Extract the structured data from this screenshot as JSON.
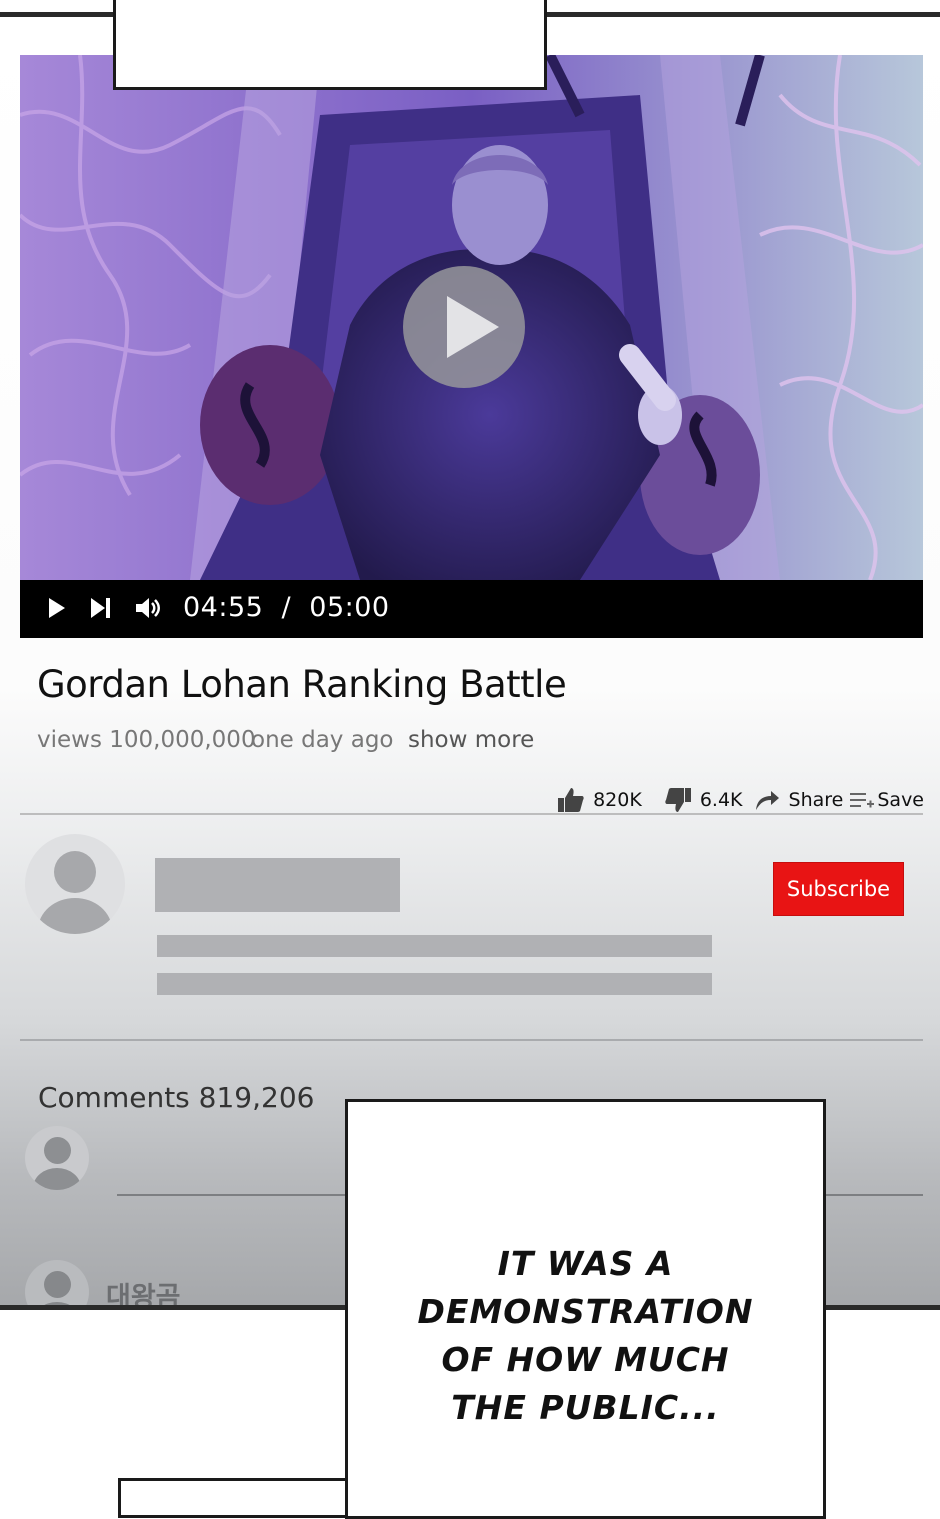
{
  "video": {
    "current_time": "04:55",
    "separator": "/",
    "duration": "05:00"
  },
  "title": "Gordan Lohan Ranking Battle",
  "meta": {
    "views": "views 100,000,000",
    "posted": "one day ago",
    "show_more": "show more"
  },
  "actions": {
    "likes": "820K",
    "dislikes": "6.4K",
    "share": "Share",
    "save": "Save"
  },
  "channel": {
    "subscribe_label": "Subscribe"
  },
  "comments": {
    "header": "Comments 819,206",
    "first_user": "대왕곰"
  },
  "caption": {
    "line1": "IT WAS A",
    "line2": "DEMONSTRATION",
    "line3": "OF HOW MUCH",
    "line4": "THE PUBLIC..."
  },
  "colors": {
    "subscribe_bg": "#e81414",
    "control_bar": "#000000",
    "video_tint": "#7b62c4"
  }
}
